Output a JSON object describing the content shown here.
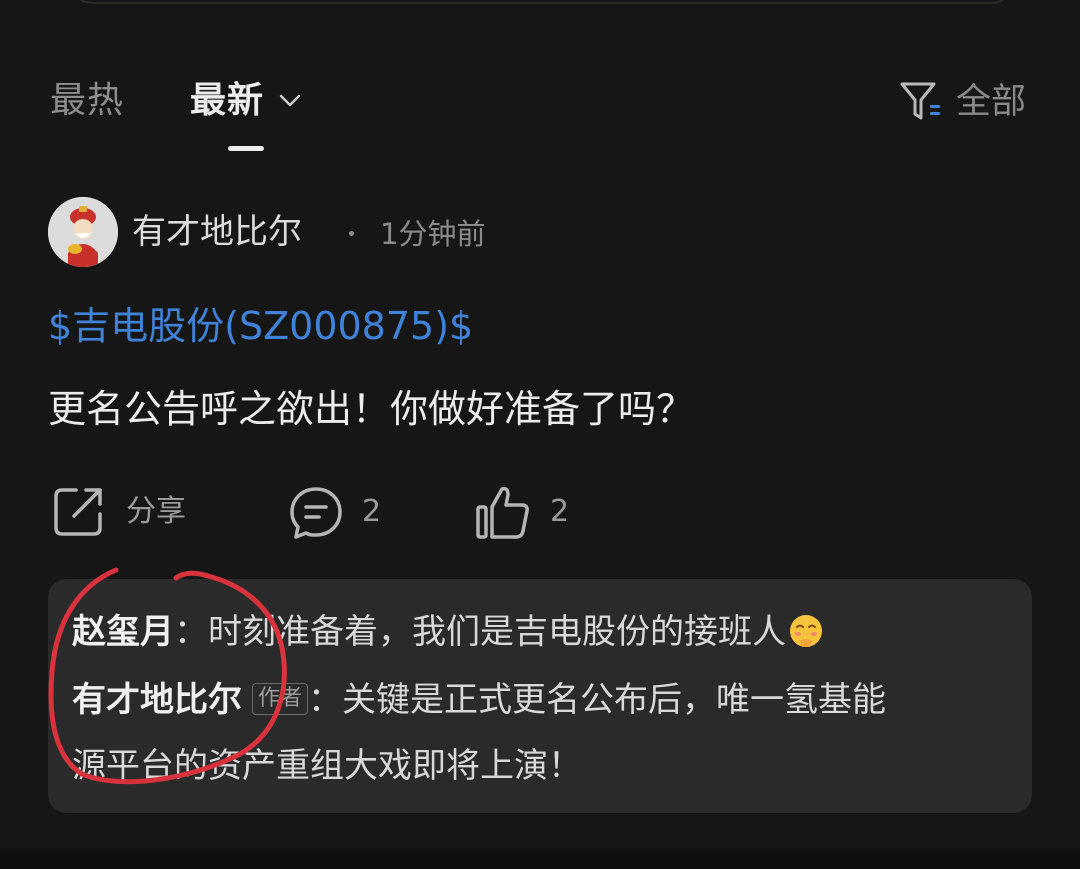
{
  "tabs": {
    "hot": "最热",
    "new": "最新"
  },
  "filter": {
    "label": "全部",
    "icon": "filter-icon"
  },
  "post": {
    "username": "有才地比尔",
    "timestamp": "1分钟前",
    "stock_tag": "$吉电股份(SZ000875)$",
    "text": "更名公告呼之欲出！你做好准备了吗？"
  },
  "actions": {
    "share_label": "分享",
    "comment_count": "2",
    "like_count": "2"
  },
  "comments": [
    {
      "name": "赵玺月",
      "separator": "：",
      "text": "时刻准备着，我们是吉电股份的接班人"
    },
    {
      "name": "有才地比尔",
      "badge": "作者",
      "separator": "：",
      "text_line1": "关键是正式更名公布后，唯一氢基能",
      "text_line2": "源平台的资产重组大戏即将上演！"
    }
  ],
  "colors": {
    "background": "#161616",
    "link": "#3f82d8",
    "annotation_red": "#d8323c"
  }
}
